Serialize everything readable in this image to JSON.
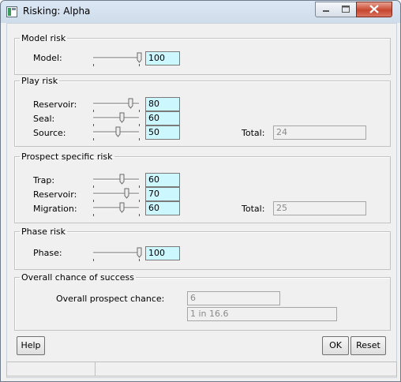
{
  "window": {
    "title": "Risking: Alpha",
    "controls": {
      "minimize": "minimize",
      "maximize": "maximize",
      "close": "close"
    }
  },
  "model_risk": {
    "legend": "Model risk",
    "rows": [
      {
        "label": "Model:",
        "value": "100",
        "slider_fraction": 1.0
      }
    ]
  },
  "play_risk": {
    "legend": "Play risk",
    "rows": [
      {
        "label": "Reservoir:",
        "value": "80",
        "slider_fraction": 0.8
      },
      {
        "label": "Seal:",
        "value": "60",
        "slider_fraction": 0.6
      },
      {
        "label": "Source:",
        "value": "50",
        "slider_fraction": 0.5
      }
    ],
    "total_label": "Total:",
    "total_value": "24"
  },
  "prospect_risk": {
    "legend": "Prospect specific risk",
    "rows": [
      {
        "label": "Trap:",
        "value": "60",
        "slider_fraction": 0.6
      },
      {
        "label": "Reservoir:",
        "value": "70",
        "slider_fraction": 0.7
      },
      {
        "label": "Migration:",
        "value": "60",
        "slider_fraction": 0.6
      }
    ],
    "total_label": "Total:",
    "total_value": "25"
  },
  "phase_risk": {
    "legend": "Phase risk",
    "rows": [
      {
        "label": "Phase:",
        "value": "100",
        "slider_fraction": 1.0
      }
    ]
  },
  "overall": {
    "legend": "Overall chance of success",
    "label": "Overall prospect chance:",
    "value": "6",
    "ratio": "1 in 16.6"
  },
  "buttons": {
    "help": "Help",
    "ok": "OK",
    "reset": "Reset"
  }
}
